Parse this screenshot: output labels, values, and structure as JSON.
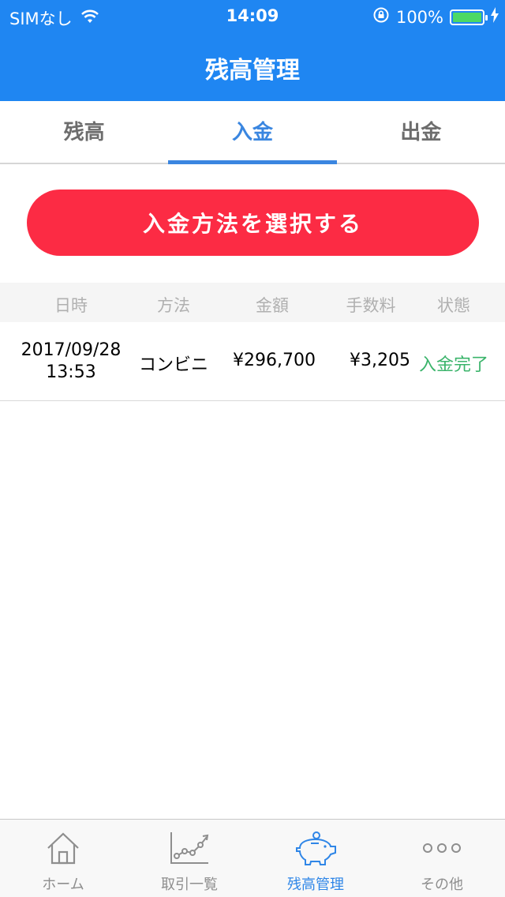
{
  "statusbar": {
    "carrier": "SIMなし",
    "time": "14:09",
    "battery_text": "100%"
  },
  "nav": {
    "title": "残高管理"
  },
  "tabs": [
    {
      "label": "残高",
      "active": false
    },
    {
      "label": "入金",
      "active": true
    },
    {
      "label": "出金",
      "active": false
    }
  ],
  "action_button": {
    "label": "入金方法を選択する"
  },
  "table": {
    "headers": [
      "日時",
      "方法",
      "金額",
      "手数料",
      "状態"
    ],
    "rows": [
      {
        "date": "2017/09/28",
        "time": "13:53",
        "method": "コンビニ",
        "amount": "¥296,700",
        "fee": "¥3,205",
        "status": "入金完了"
      }
    ]
  },
  "tabbar": [
    {
      "label": "ホーム",
      "icon": "home-icon"
    },
    {
      "label": "取引一覧",
      "icon": "chart-icon"
    },
    {
      "label": "残高管理",
      "icon": "piggy-bank-icon",
      "active": true
    },
    {
      "label": "その他",
      "icon": "more-icon"
    }
  ],
  "colors": {
    "header": "#1f86f2",
    "accent": "#3a86e0",
    "button": "#fc2b44",
    "status_done": "#3bb46b"
  }
}
